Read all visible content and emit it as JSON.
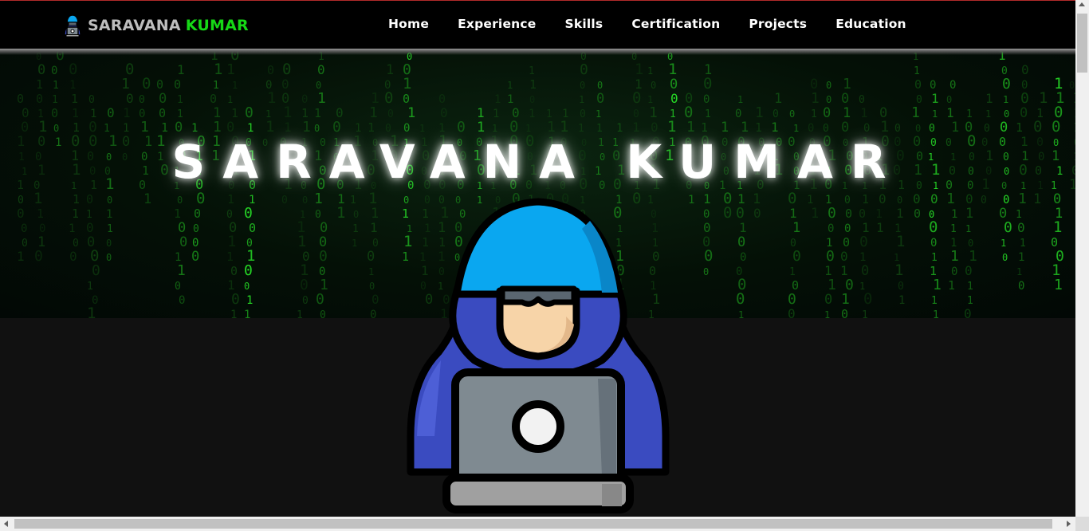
{
  "brand": {
    "first_name": "SARAVANA",
    "last_name": "KUMAR",
    "logo_icon": "hacker-icon",
    "first_color": "#bdbdbd",
    "last_color": "#16d816"
  },
  "nav": {
    "items": [
      {
        "label": "Home"
      },
      {
        "label": "Experience"
      },
      {
        "label": "Skills"
      },
      {
        "label": "Certification"
      },
      {
        "label": "Projects"
      },
      {
        "label": "Education"
      }
    ]
  },
  "hero": {
    "title": "SARAVANA KUMAR",
    "background": "matrix-code-rain",
    "illustration": "hacker-with-laptop"
  },
  "colors": {
    "accent_green": "#16d816",
    "hood_blue": "#3a4bc0",
    "cap_blue": "#0aa7f0",
    "laptop_gray": "#7f8a91",
    "page_bg": "#111111"
  }
}
